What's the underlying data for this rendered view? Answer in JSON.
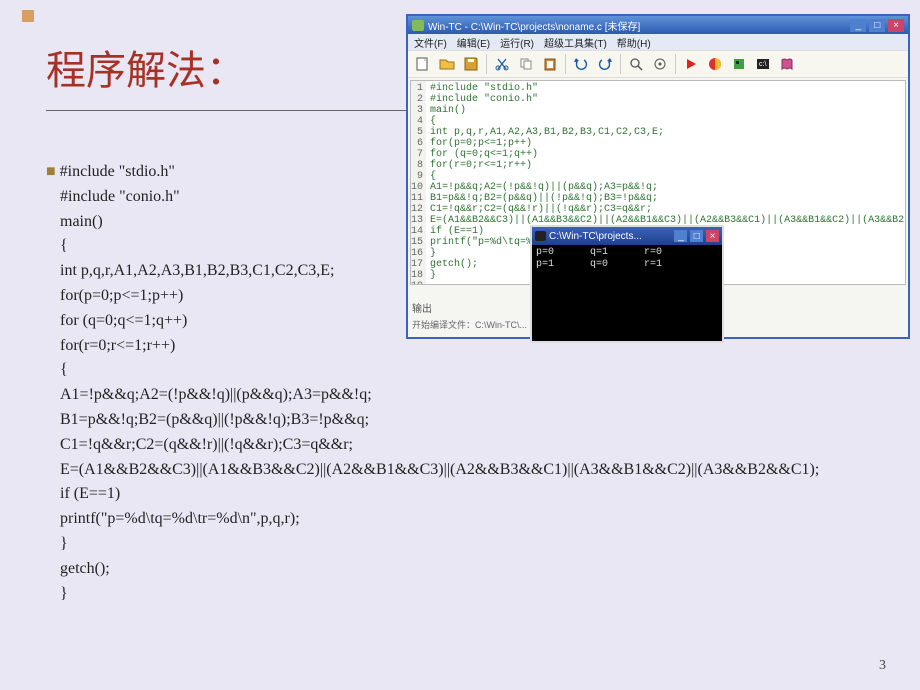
{
  "slide": {
    "title": "程序解法：",
    "page_number": "3",
    "code_lines": [
      "#include \"stdio.h\"",
      "#include \"conio.h\"",
      "main()",
      "{",
      "   int p,q,r,A1,A2,A3,B1,B2,B3,C1,C2,C3,E;",
      "   for(p=0;p<=1;p++)",
      "     for (q=0;q<=1;q++)",
      "      for(r=0;r<=1;r++)",
      "         {",
      "           A1=!p&&q;A2=(!p&&!q)||(p&&q);A3=p&&!q;",
      "           B1=p&&!q;B2=(p&&q)||(!p&&!q);B3=!p&&q;",
      "           C1=!q&&r;C2=(q&&!r)||(!q&&r);C3=q&&r;",
      "E=(A1&&B2&&C3)||(A1&&B3&&C2)||(A2&&B1&&C3)||(A2&&B3&&C1)||(A3&&B1&&C2)||(A3&&B2&&C1);",
      "           if (E==1)",
      "             printf(\"p=%d\\tq=%d\\tr=%d\\n\",p,q,r);",
      "          }",
      "    getch();",
      "}"
    ]
  },
  "ide": {
    "title": "Win-TC - C:\\Win-TC\\projects\\noname.c [未保存]",
    "menu": [
      "文件(F)",
      "编辑(E)",
      "运行(R)",
      "超级工具集(T)",
      "帮助(H)"
    ],
    "output_label": "输出",
    "status_label": "开始编译文件：C:\\Win-TC\\..."
  },
  "ide_code": {
    "lines": [
      "#include \"stdio.h\"",
      "#include \"conio.h\"",
      "main()",
      "{",
      "   int p,q,r,A1,A2,A3,B1,B2,B3,C1,C2,C3,E;",
      "   for(p=0;p<=1;p++)",
      "     for (q=0;q<=1;q++)",
      "       for(r=0;r<=1;r++)",
      "       {",
      "         A1=!p&&q;A2=(!p&&!q)||(p&&q);A3=p&&!q;",
      "         B1=p&&!q;B2=(p&&q)||(!p&&!q);B3=!p&&q;",
      "         C1=!q&&r;C2=(q&&!r)||(!q&&r);C3=q&&r;",
      "E=(A1&&B2&&C3)||(A1&&B3&&C2)||(A2&&B1&&C3)||(A2&&B3&&C1)||(A3&&B1&&C2)||(A3&&B2",
      "         if (E==1)",
      "          printf(\"p=%d\\tq=%d\\tr=%d\\n\",p,q,r);",
      "       }",
      "   getch();",
      "}",
      ""
    ]
  },
  "console": {
    "title": "C:\\Win-TC\\projects...",
    "output": "p=0      q=1      r=0\np=1      q=0      r=1"
  }
}
